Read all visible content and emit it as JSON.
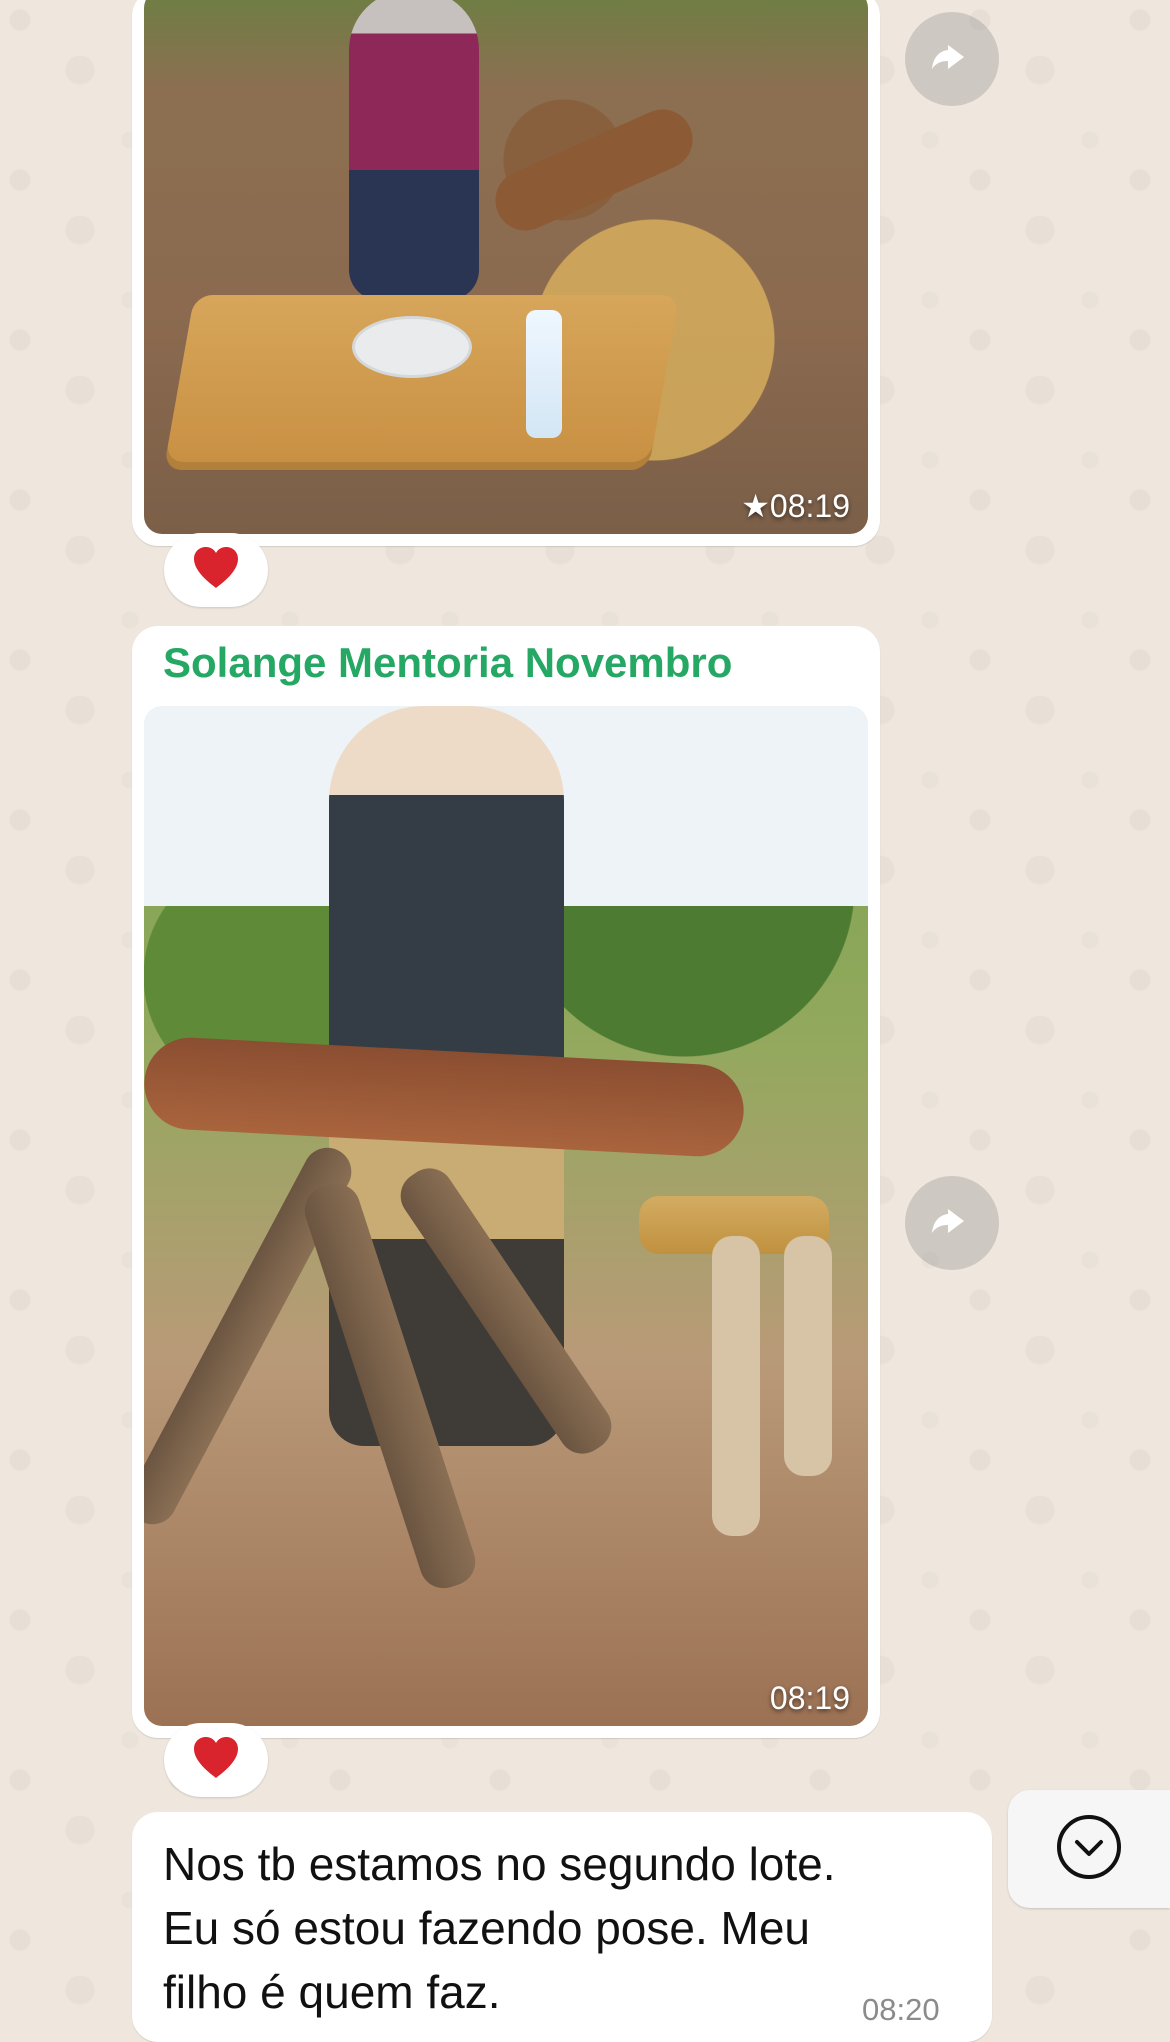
{
  "theme": {
    "background": "#efe7dd",
    "bubble": "#ffffff",
    "sender_color": "#25a864",
    "timestamp_color": "#8b8b8b",
    "reaction_heart": "#d9232d"
  },
  "messages": [
    {
      "type": "media",
      "timestamp": "★08:19",
      "reaction": "heart-icon",
      "forward_icon": "forward-icon"
    },
    {
      "type": "media",
      "sender": "Solange Mentoria Novembro",
      "timestamp": "08:19",
      "reaction": "heart-icon",
      "forward_icon": "forward-icon"
    },
    {
      "type": "text",
      "text": "Nos tb estamos no segundo lote.\nEu só estou fazendo pose. Meu\nfilho é quem faz.",
      "timestamp": "08:20"
    }
  ],
  "controls": {
    "scroll_down_icon": "chevron-down-icon"
  }
}
